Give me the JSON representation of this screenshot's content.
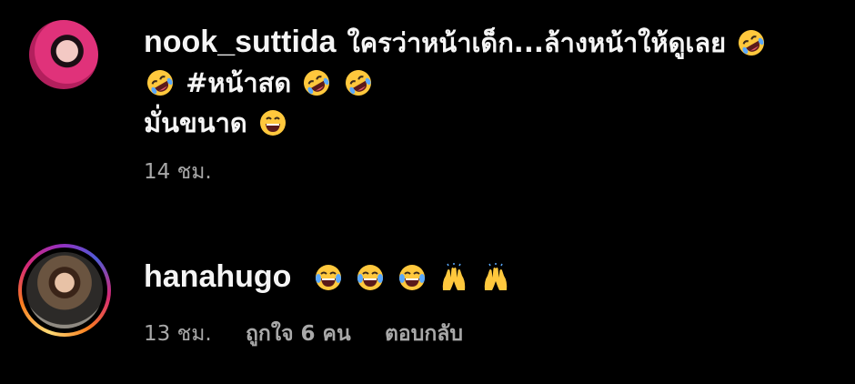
{
  "comments": [
    {
      "username": "nook_suttida",
      "text_part1": "ใครว่าหน้าเด็ก...ล้างหน้าให้ดูเลย",
      "hashtag": "#หน้าสด",
      "text_part3": "มั่นขนาด",
      "emoji_icons": [
        "rofl-emoji",
        "rofl-emoji",
        "rofl-emoji",
        "rofl-emoji",
        "grin-emoji"
      ],
      "time": "14 ชม."
    },
    {
      "username": "hanahugo",
      "emoji_icons": [
        "tears-of-joy-emoji",
        "tears-of-joy-emoji",
        "tears-of-joy-emoji",
        "raised-hands-emoji",
        "raised-hands-emoji"
      ],
      "time": "13 ชม.",
      "likes_label": "ถูกใจ 6 คน",
      "reply_label": "ตอบกลับ"
    }
  ]
}
